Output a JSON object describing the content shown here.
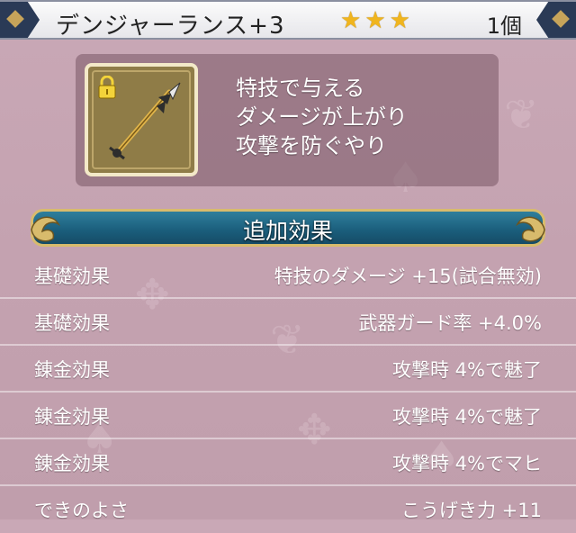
{
  "header": {
    "item_name": "デンジャーランス+3",
    "stars": 3,
    "count": "1個"
  },
  "item": {
    "icon": "spear-icon",
    "locked": true,
    "description": [
      "特技で与える",
      "ダメージが上がり",
      "攻撃を防ぐやり"
    ]
  },
  "section": {
    "title": "追加効果"
  },
  "effects": [
    {
      "label": "基礎効果",
      "value": "特技のダメージ +15(試合無効)"
    },
    {
      "label": "基礎効果",
      "value": "武器ガード率 +4.0%"
    },
    {
      "label": "錬金効果",
      "value": "攻撃時 4%で魅了"
    },
    {
      "label": "錬金効果",
      "value": "攻撃時 4%で魅了"
    },
    {
      "label": "錬金効果",
      "value": "攻撃時 4%でマヒ"
    },
    {
      "label": "できのよさ",
      "value": "こうげき力 +11"
    }
  ],
  "colors": {
    "star": "#f0b51e",
    "banner": "#1a5d7b",
    "background": "#c4a2b0"
  }
}
